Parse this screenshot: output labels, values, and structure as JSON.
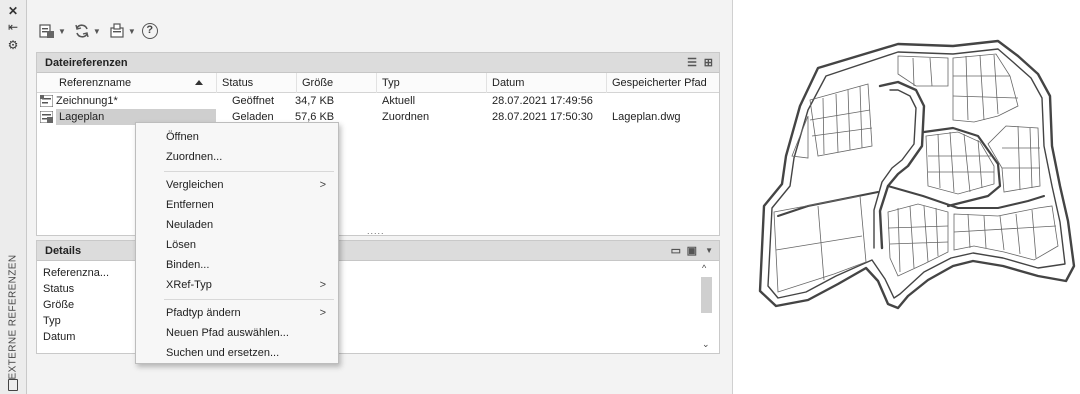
{
  "side_strip": {
    "label": "EXTERNE REFERENZEN",
    "icons": [
      "close-icon",
      "autohide-icon",
      "properties-icon",
      "palette-icon"
    ]
  },
  "toolbar": {
    "buttons": [
      "attach-dwg-icon",
      "refresh-icon",
      "change-path-icon",
      "help-icon"
    ]
  },
  "file_references": {
    "title": "Dateireferenzen",
    "columns": [
      "Referenzname",
      "Status",
      "Größe",
      "Typ",
      "Datum",
      "Gespeicherter Pfad"
    ],
    "rows": [
      {
        "name": "Zeichnung1*",
        "status": "Geöffnet",
        "size": "34,7 KB",
        "type": "Aktuell",
        "date": "28.07.2021 17:49:56",
        "path": ""
      },
      {
        "name": "Lageplan",
        "status": "Geladen",
        "size": "57,6 KB",
        "type": "Zuordnen",
        "date": "28.07.2021 17:50:30",
        "path": "Lageplan.dwg"
      }
    ],
    "grip": "....."
  },
  "details": {
    "title": "Details",
    "labels": [
      "Referenzna...",
      "Status",
      "Größe",
      "Typ",
      "Datum"
    ]
  },
  "context_menu": {
    "items": [
      "Öffnen",
      "Zuordnen...",
      "Vergleichen",
      "Entfernen",
      "Neuladen",
      "Lösen",
      "Binden...",
      "XRef-Typ",
      "Pfadtyp ändern",
      "Neuen Pfad auswählen...",
      "Suchen und ersetzen..."
    ],
    "submenu_marker": ">"
  },
  "colors": {
    "panel_header": "#dcdcdc",
    "selection": "#cfcfcf",
    "map_road": "#444444"
  }
}
